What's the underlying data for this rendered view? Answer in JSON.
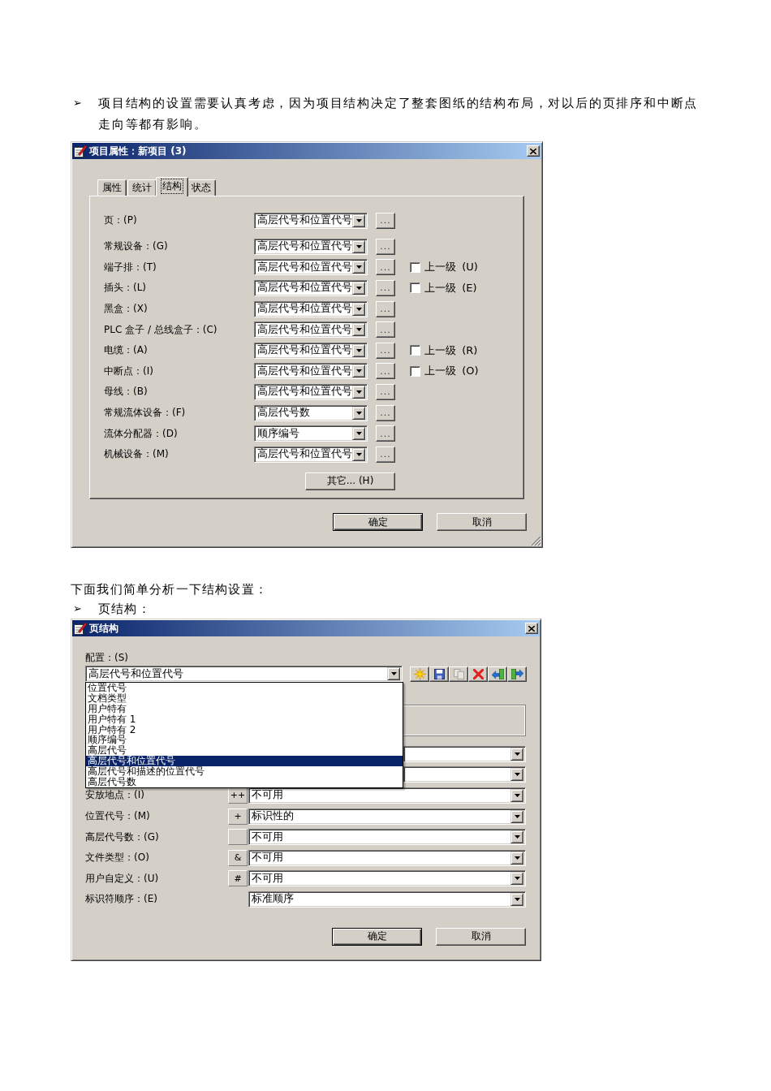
{
  "intro": {
    "bullet": "➢",
    "text": "项目结构的设置需要认真考虑，因为项目结构决定了整套图纸的结构布局，对以后的页排序和中断点走向等都有影响。"
  },
  "project_dialog": {
    "title": "项目属性：新项目 (3)",
    "tabs": [
      {
        "label": "属性",
        "selected": false
      },
      {
        "label": "统计",
        "selected": false
      },
      {
        "label": "结构",
        "selected": true
      },
      {
        "label": "状态",
        "selected": false
      }
    ],
    "rows": [
      {
        "label": "页：(P)",
        "value": "高层代号和位置代号",
        "button": "..."
      },
      {
        "label": "常规设备：(G)",
        "value": "高层代号和位置代号",
        "button": "..."
      },
      {
        "label": "端子排：(T)",
        "value": "高层代号和位置代号",
        "button": "...",
        "checkbox": {
          "label": "上一级 (U)",
          "checked": false
        }
      },
      {
        "label": "插头：(L)",
        "value": "高层代号和位置代号",
        "button": "...",
        "checkbox": {
          "label": "上一级 (E)",
          "checked": false
        }
      },
      {
        "label": "黑盒：(X)",
        "value": "高层代号和位置代号",
        "button": "..."
      },
      {
        "label": "PLC 盒子 / 总线盒子：(C)",
        "value": "高层代号和位置代号",
        "button": "..."
      },
      {
        "label": "电缆：(A)",
        "value": "高层代号和位置代号",
        "button": "...",
        "checkbox": {
          "label": "上一级 (R)",
          "checked": false
        }
      },
      {
        "label": "中断点：(I)",
        "value": "高层代号和位置代号",
        "button": "...",
        "checkbox": {
          "label": "上一级 (O)",
          "checked": false
        }
      },
      {
        "label": "母线：(B)",
        "value": "高层代号和位置代号",
        "button": "..."
      },
      {
        "label": "常规流体设备：(F)",
        "value": "高层代号数",
        "button": "..."
      },
      {
        "label": "流体分配器：(D)",
        "value": "顺序编号",
        "button": "..."
      },
      {
        "label": "机械设备：(M)",
        "value": "高层代号和位置代号",
        "button": "..."
      }
    ],
    "other_button": "其它... (H)",
    "buttons": [
      {
        "label": "确定",
        "default": true
      },
      {
        "label": "取消",
        "default": false
      }
    ]
  },
  "analysis_text": "下面我们简单分析一下结构设置：",
  "section": {
    "bullet": "➢",
    "text": "页结构："
  },
  "page_dialog": {
    "title": "页结构",
    "config": {
      "label": "配置：(S)",
      "value": "高层代号和位置代号",
      "expanded": true,
      "options": [
        {
          "label": "位置代号",
          "selected": false
        },
        {
          "label": "文档类型",
          "selected": false
        },
        {
          "label": "用户特有",
          "selected": false
        },
        {
          "label": "用户特有 1",
          "selected": false
        },
        {
          "label": "用户特有 2",
          "selected": false
        },
        {
          "label": "顺序编号",
          "selected": false
        },
        {
          "label": "高层代号",
          "selected": false
        },
        {
          "label": "高层代号和位置代号",
          "selected": true
        },
        {
          "label": "高层代号和描述的位置代号",
          "selected": false
        },
        {
          "label": "高层代号数",
          "selected": false
        }
      ]
    },
    "toolbar": [
      {
        "kind": "new",
        "disabled": false
      },
      {
        "kind": "save",
        "disabled": false
      },
      {
        "kind": "copy",
        "disabled": true
      },
      {
        "kind": "delete",
        "disabled": false
      },
      {
        "kind": "import",
        "disabled": false
      },
      {
        "kind": "export",
        "disabled": false
      }
    ],
    "covered": [
      {
        "kind": "group"
      },
      {
        "kind": "combo"
      },
      {
        "kind": "combo"
      }
    ],
    "fields": [
      {
        "label": "安放地点：(I)",
        "kind": "prefix",
        "prefix": "++",
        "value": "不可用"
      },
      {
        "label": "位置代号：(M)",
        "kind": "prefix",
        "prefix": "+",
        "value": "标识性的"
      },
      {
        "label": "高层代号数：(G)",
        "kind": "prefix",
        "value": "不可用"
      },
      {
        "label": "文件类型：(O)",
        "kind": "prefix",
        "prefix": "&",
        "value": "不可用"
      },
      {
        "label": "用户自定义：(U)",
        "kind": "prefix",
        "prefix": "#",
        "value": "不可用"
      },
      {
        "label": "标识符顺序：(E)",
        "kind": "plain",
        "value": "标准顺序"
      }
    ],
    "buttons": [
      {
        "label": "确定",
        "default": true
      },
      {
        "label": "取消",
        "default": false
      }
    ]
  }
}
